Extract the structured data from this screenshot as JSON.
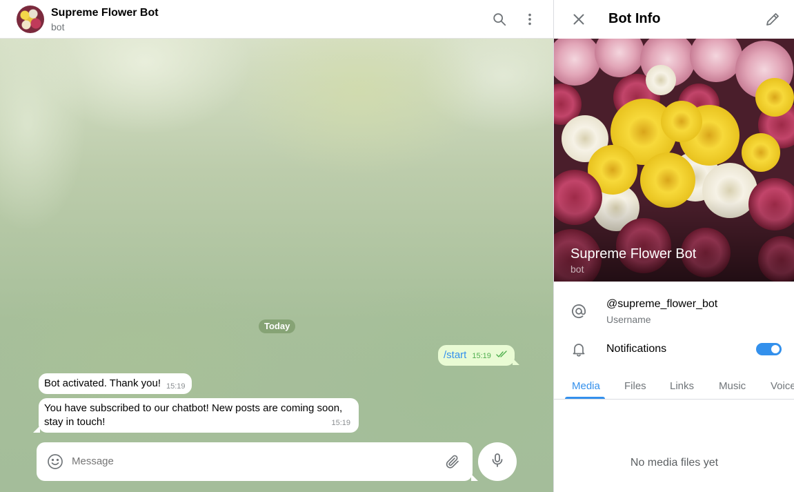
{
  "chat": {
    "title": "Supreme Flower Bot",
    "status": "bot",
    "date_separator": "Today",
    "messages": [
      {
        "direction": "out",
        "text": "/start",
        "time": "15:19"
      },
      {
        "direction": "in",
        "text": "Bot activated. Thank you!",
        "time": "15:19"
      },
      {
        "direction": "in",
        "text_line1": "You have subscribed to our chatbot! New posts are coming soon,",
        "text_line2": "stay in touch!",
        "time": "15:19"
      }
    ],
    "composer": {
      "placeholder": "Message"
    }
  },
  "panel": {
    "title": "Bot Info",
    "profile_name": "Supreme Flower Bot",
    "profile_status": "bot",
    "username": "@supreme_flower_bot",
    "username_label": "Username",
    "notifications_label": "Notifications",
    "notifications_enabled": true,
    "tabs": [
      "Media",
      "Files",
      "Links",
      "Music",
      "Voice"
    ],
    "active_tab": "Media",
    "empty_text": "No media files yet"
  },
  "colors": {
    "accent": "#3390ec",
    "outgoing_bubble": "#e9fbd4",
    "check_marks": "#4fae4e"
  },
  "icons": [
    "search-icon",
    "more-vertical-icon",
    "close-icon",
    "edit-pencil-icon",
    "at-sign-icon",
    "bell-icon",
    "emoji-icon",
    "attach-icon",
    "microphone-icon",
    "read-checks-icon"
  ]
}
